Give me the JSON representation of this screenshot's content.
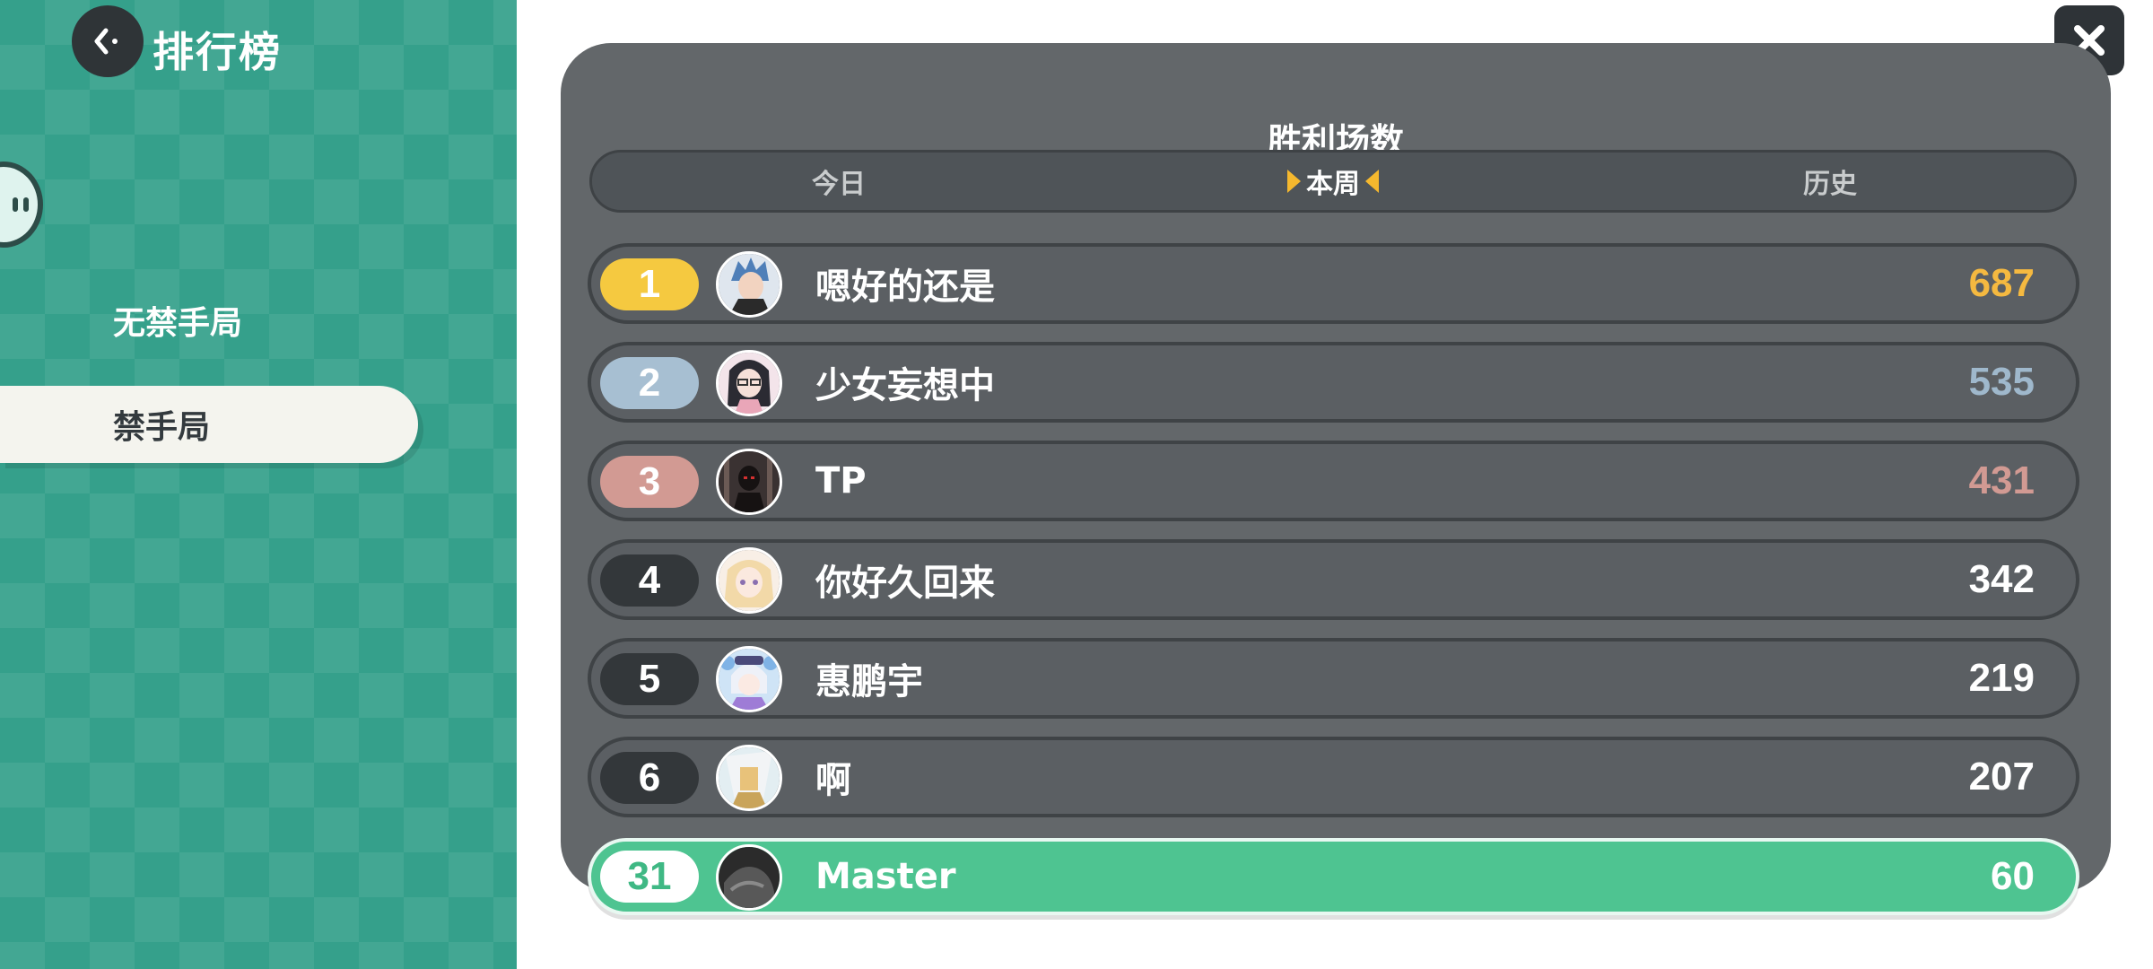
{
  "header": {
    "title": "排行榜"
  },
  "sidebar": {
    "items": [
      {
        "label": "无禁手局",
        "active": false
      },
      {
        "label": "禁手局",
        "active": true
      }
    ]
  },
  "panel": {
    "title": "胜利场数",
    "tabs": [
      {
        "label": "今日",
        "active": false
      },
      {
        "label": "本周",
        "active": true
      },
      {
        "label": "历史",
        "active": false
      }
    ]
  },
  "leaderboard": [
    {
      "rank": "1",
      "name": "嗯好的还是",
      "score": "687",
      "score_color": "#f5b940",
      "avatar_icon": "player-avatar-icon"
    },
    {
      "rank": "2",
      "name": "少女妄想中",
      "score": "535",
      "score_color": "#9fb8cc",
      "avatar_icon": "player-avatar-icon"
    },
    {
      "rank": "3",
      "name": "TP",
      "score": "431",
      "score_color": "#d29a93",
      "avatar_icon": "player-avatar-icon"
    },
    {
      "rank": "4",
      "name": "你好久回来",
      "score": "342",
      "score_color": "#ffffff",
      "avatar_icon": "player-avatar-icon"
    },
    {
      "rank": "5",
      "name": "惠鹏宇",
      "score": "219",
      "score_color": "#ffffff",
      "avatar_icon": "player-avatar-icon"
    },
    {
      "rank": "6",
      "name": "啊",
      "score": "207",
      "score_color": "#ffffff",
      "avatar_icon": "player-avatar-icon"
    }
  ],
  "my_entry": {
    "rank": "31",
    "name": "Master",
    "score": "60"
  },
  "colors": {
    "sidebar_bg": "#35a08b",
    "panel_bg": "#63676a",
    "gold": "#f5c940",
    "silver": "#a7bfd2",
    "bronze": "#d29a93",
    "self_highlight": "#4ec491",
    "active_tab_marker": "#f5b82e"
  },
  "icons": {
    "back": "back-arrow-icon",
    "close": "close-icon"
  }
}
